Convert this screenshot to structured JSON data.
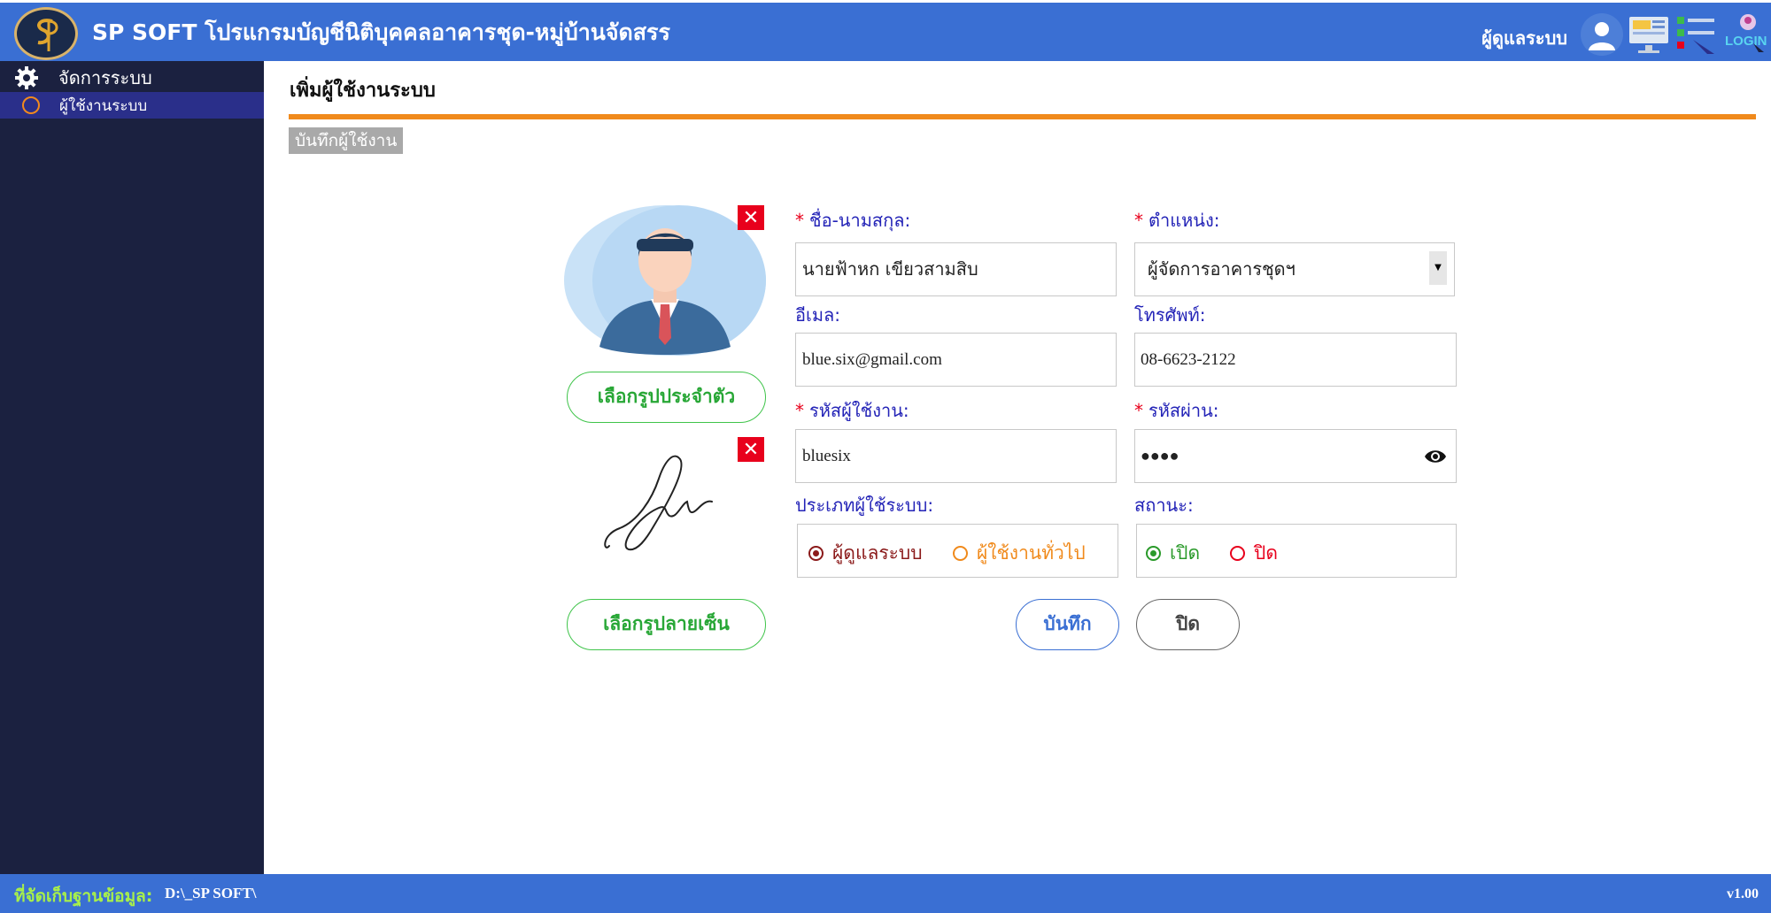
{
  "header": {
    "title": "SP SOFT โปรแกรมบัญชีนิติบุคคลอาคารชุด-หมู่บ้านจัดสรร",
    "user_label": "ผู้ดูแลระบบ",
    "icons": [
      "logo-sp",
      "user-avatar-icon",
      "monitor-icon",
      "list-icon",
      "login-icon"
    ],
    "login_text": "LOGIN"
  },
  "sidebar": {
    "group_label": "จัดการระบบ",
    "items": [
      {
        "label": "ผู้ใช้งานระบบ",
        "active": true
      }
    ]
  },
  "main": {
    "page_title": "เพิ่มผู้ใช้งานระบบ",
    "tab_label": "บันทึกผู้ใช้งาน",
    "choose_photo_label": "เลือกรูปประจำตัว",
    "choose_signature_label": "เลือกรูปลายเซ็น",
    "delete_glyph": "✕",
    "form": {
      "name": {
        "label": "ชื่อ-นามสกุล:",
        "required": true,
        "value": "นายฟ้าหก   เขียวสามสิบ"
      },
      "position": {
        "label": "ตำแหน่ง:",
        "required": true,
        "value": "ผู้จัดการอาคารชุดฯ"
      },
      "email": {
        "label": "อีเมล:",
        "value": "blue.six@gmail.com"
      },
      "phone": {
        "label": "โทรศัพท์:",
        "value": "08-6623-2122"
      },
      "username": {
        "label": "รหัสผู้ใช้งาน:",
        "required": true,
        "value": "bluesix"
      },
      "password": {
        "label": "รหัสผ่าน:",
        "required": true,
        "value": "●●●●"
      },
      "user_type": {
        "label": "ประเภทผู้ใช้ระบบ:",
        "options": [
          "ผู้ดูแลระบบ",
          "ผู้ใช้งานทั่วไป"
        ],
        "selected": "ผู้ดูแลระบบ"
      },
      "status": {
        "label": "สถานะ:",
        "options": [
          "เปิด",
          "ปิด"
        ],
        "selected": "เปิด"
      },
      "required_mark": "*"
    },
    "save_label": "บันทึก",
    "close_label": "ปิด"
  },
  "footer": {
    "db_label": "ที่จัดเก็บฐานข้อมูล:",
    "db_path": "D:\\_SP SOFT\\",
    "version": "v1.00"
  },
  "colors": {
    "header_bg": "#3a6fd3",
    "sidebar_bg": "#1b2140",
    "accent_orange": "#f08a1c",
    "label_blue": "#2323b7",
    "green_button": "#3fc44a",
    "required_red": "#e8001c"
  }
}
